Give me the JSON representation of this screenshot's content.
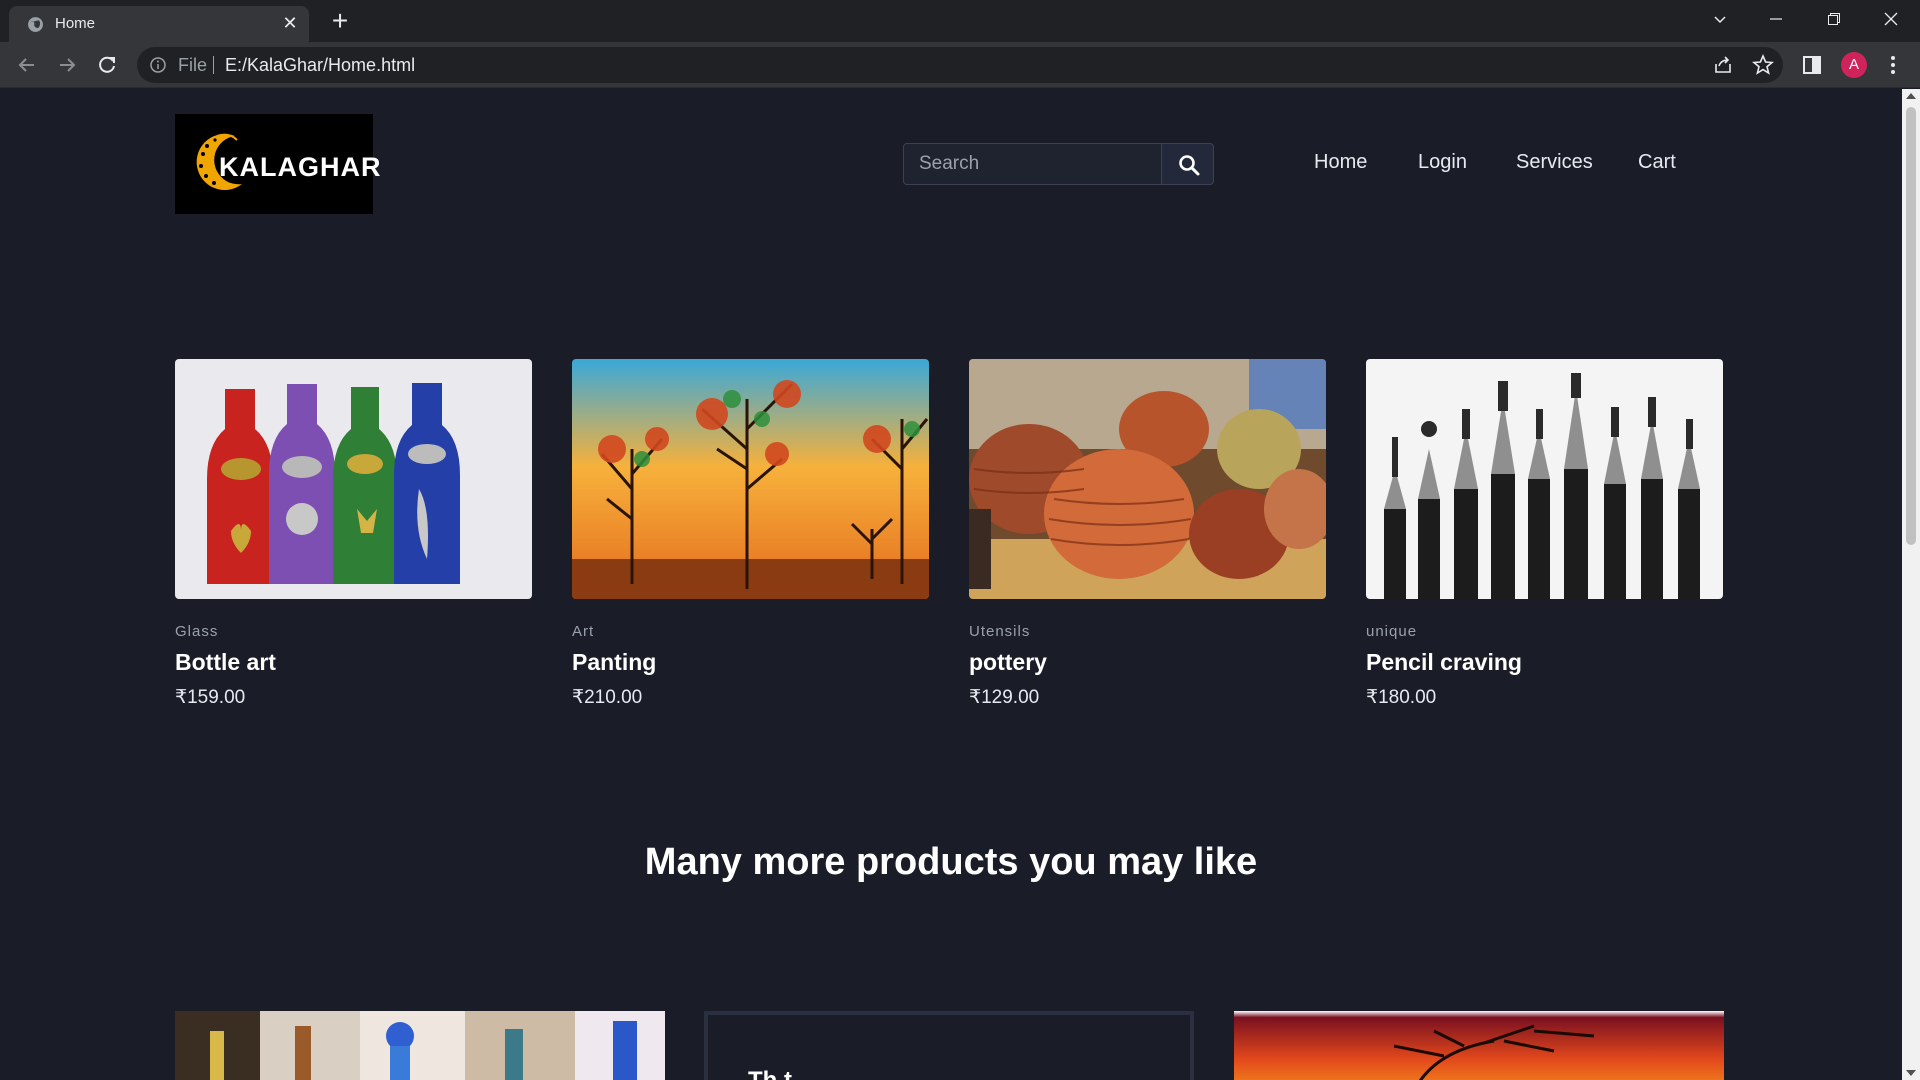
{
  "browser": {
    "tab_title": "Home",
    "tab_close": "✕",
    "new_tab": "+",
    "url_scheme": "File",
    "url": "E:/KalaGhar/Home.html",
    "profile_initial": "A",
    "window_controls": {
      "minimize": "—",
      "restore": "❐",
      "close": "✕",
      "tab_search": "⌄"
    }
  },
  "header": {
    "logo_text": "KALAGHAR",
    "search": {
      "placeholder": "Search"
    },
    "nav": [
      "Home",
      "Login",
      "Services",
      "Cart"
    ]
  },
  "products": [
    {
      "category": "Glass",
      "name": "Bottle art",
      "price": "₹159.00"
    },
    {
      "category": "Art",
      "name": "Panting",
      "price": "₹210.00"
    },
    {
      "category": "Utensils",
      "name": "pottery",
      "price": "₹129.00"
    },
    {
      "category": "unique",
      "name": "Pencil craving",
      "price": "₹180.00"
    }
  ],
  "more_section": {
    "title": "Many more products you may like",
    "peek_text": "Th   t"
  },
  "colors": {
    "page_bg": "#1a1d27",
    "chrome_dark": "#202124",
    "chrome_toolbar": "#35363a",
    "avatar": "#d0235b",
    "logo_accent": "#f0a500"
  }
}
